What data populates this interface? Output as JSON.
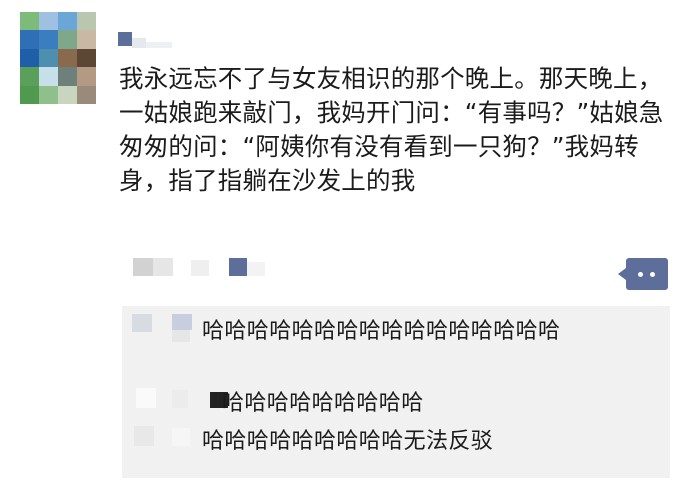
{
  "post": {
    "author_avatar_icon": "pixelated-avatar-icon",
    "author_name_icon": "blurred-name-icon",
    "text": "我永远忘不了与女友相识的那个晚上。那天晚上，一姑娘跑来敲门，我妈开门问：“有事吗？”姑娘急匆匆的问：“阿姨你有没有看到一只狗？”我妈转身，指了指躺在沙发上的我",
    "more_icon": "more-dots-icon"
  },
  "comments": [
    {
      "author_icon": "blurred-name-icon",
      "text": "哈哈哈哈哈哈哈哈哈哈哈哈哈哈哈哈"
    },
    {
      "author_icon": "blurred-name-icon",
      "text": "哈哈哈哈哈哈哈哈哈"
    },
    {
      "author_icon": "blurred-name-icon",
      "text": "哈哈哈哈哈哈哈哈哈无法反驳"
    }
  ],
  "colors": {
    "comment_bg": "#f1f1f1",
    "action_button": "#5d6e9a"
  }
}
